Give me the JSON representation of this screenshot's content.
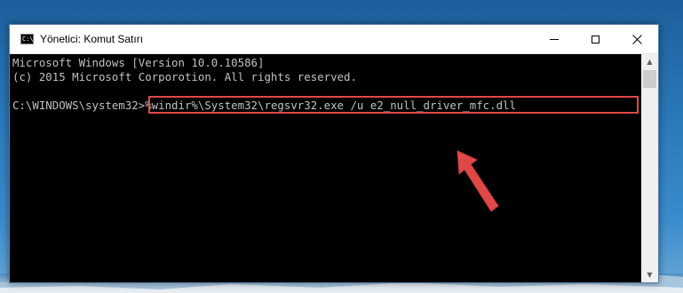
{
  "window": {
    "title": "Yönetici: Komut Satırı",
    "icon_label": "C:\\",
    "controls": {
      "minimize": "minimize",
      "maximize": "maximize",
      "close": "✕"
    }
  },
  "console": {
    "lines": [
      "Microsoft Windows [Version 10.0.10586]",
      "(c) 2015 Microsoft Corporotion. All rights reserved."
    ],
    "prompt": "C:\\WINDOWS\\system32>",
    "command": "%windir%\\System32\\regsvr32.exe /u e2_null_driver_mfc.dll"
  },
  "scrollbar": {
    "up": "▲",
    "down": "▼"
  },
  "colors": {
    "console_bg": "#000000",
    "console_text": "#c0c0c0",
    "highlight": "#e04848",
    "arrow": "#e04848"
  }
}
